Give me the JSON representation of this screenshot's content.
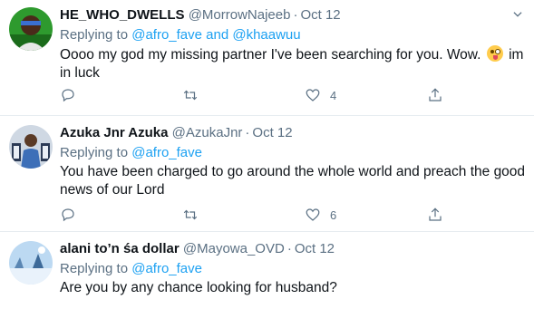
{
  "tweets": [
    {
      "name": "HE_WHO_DWELLS",
      "handle": "@MorrowNajeeb",
      "date": "Oct 12",
      "replying_prefix": "Replying to",
      "replying_to": "@afro_fave and @khaawuu",
      "text_part1": "Oooo my god my missing partner I've been searching for you. Wow.",
      "text_part2": "im in luck",
      "emoji_icon": "winking-face-with-tongue-icon",
      "counts": {
        "reply": "",
        "retweet": "",
        "like": "4"
      },
      "avatar_colors": [
        "#1b8a1b",
        "#e8e8e8",
        "#3a6fd0"
      ]
    },
    {
      "name": "Azuka Jnr Azuka",
      "handle": "@AzukaJnr",
      "date": "Oct 12",
      "replying_prefix": "Replying to",
      "replying_to": "@afro_fave",
      "text_part1": "You have been charged to go around the whole world and preach the good news of our Lord",
      "counts": {
        "reply": "",
        "retweet": "",
        "like": "6"
      },
      "avatar_colors": [
        "#cfd8e3",
        "#2b3a55",
        "#9fb9d8"
      ]
    },
    {
      "name": "alani to’n śa dollar",
      "handle": "@Mayowa_OVD",
      "date": "Oct 12",
      "replying_prefix": "Replying to",
      "replying_to": "@afro_fave",
      "text_part1": "Are you by any chance looking for husband?",
      "counts": {
        "reply": "",
        "retweet": "",
        "like": ""
      },
      "avatar_colors": [
        "#9ec6ea",
        "#e9f2fb",
        "#5a86b3"
      ]
    }
  ],
  "icons": {
    "more": "chevron-down-icon",
    "reply": "reply-icon",
    "retweet": "retweet-icon",
    "like": "heart-icon",
    "share": "share-icon"
  },
  "colors": {
    "link": "#1da1f2",
    "secondary_text": "#5b7083",
    "divider": "#e6ecf0"
  }
}
